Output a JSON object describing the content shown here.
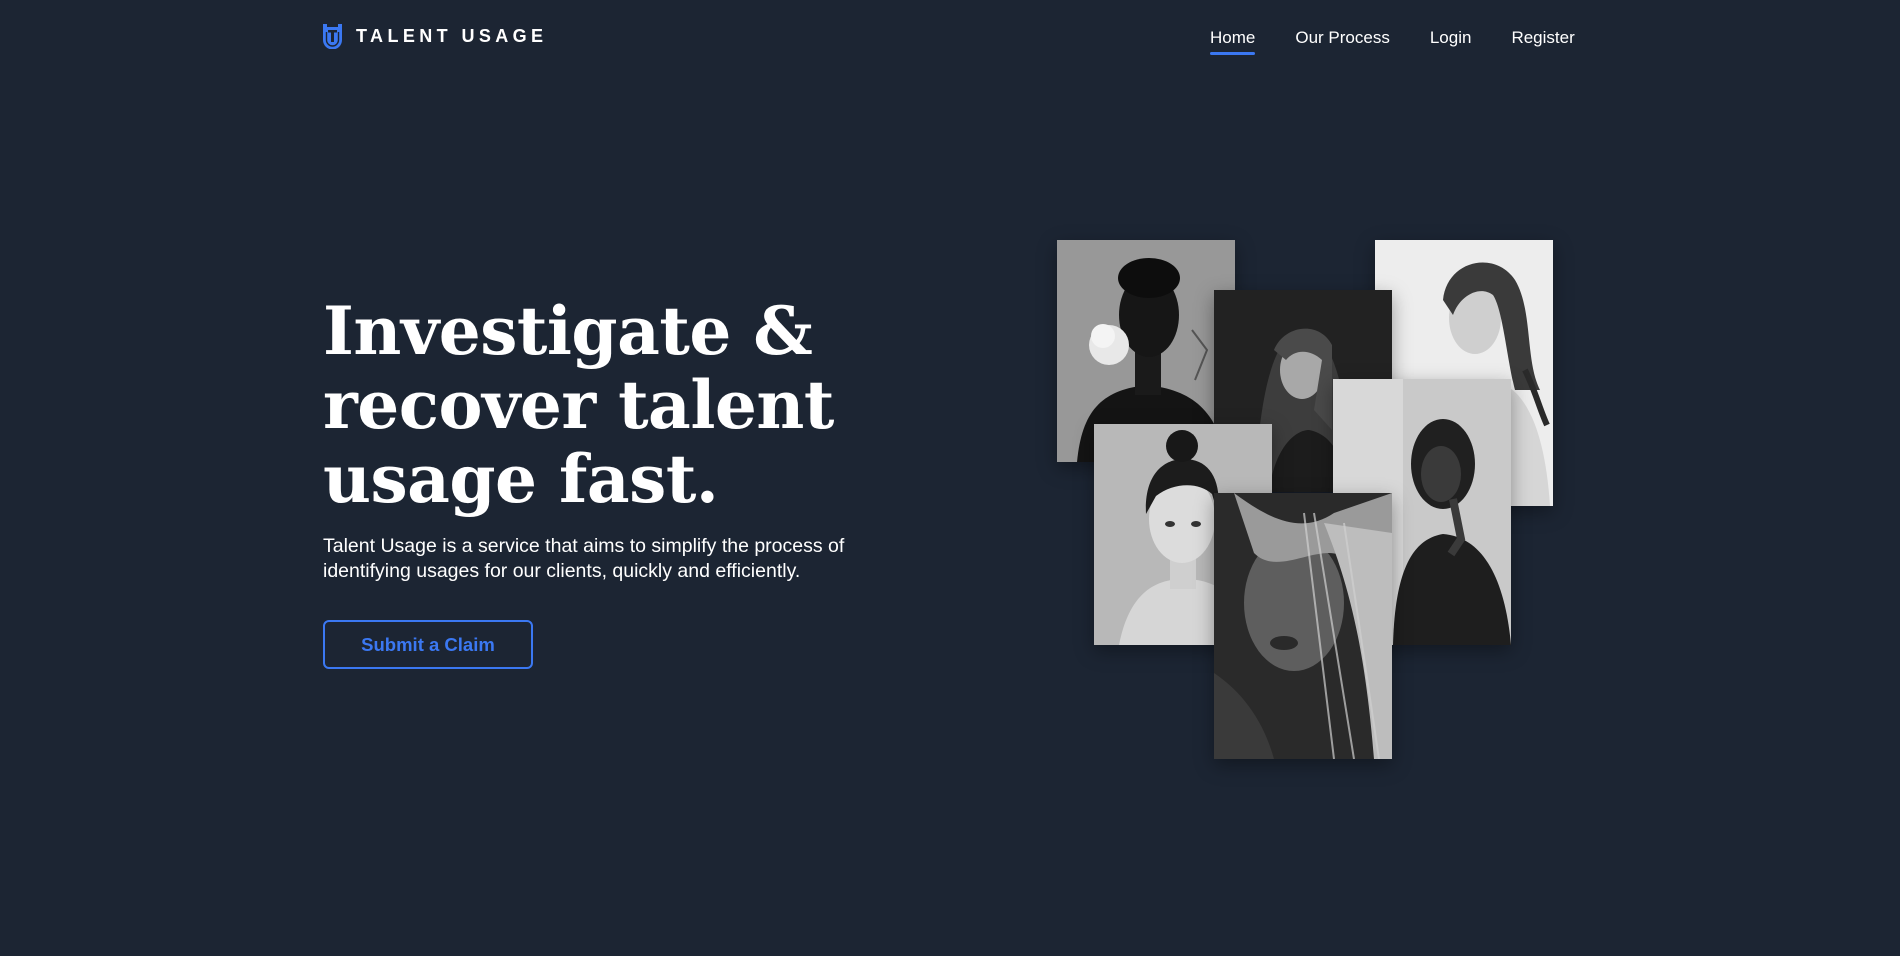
{
  "header": {
    "logo_text": "TALENT USAGE",
    "nav": [
      {
        "label": "Home",
        "active": true
      },
      {
        "label": "Our Process",
        "active": false
      },
      {
        "label": "Login",
        "active": false
      },
      {
        "label": "Register",
        "active": false
      }
    ]
  },
  "hero": {
    "headline_lines": [
      "Investigate &",
      "recover talent",
      "usage fast."
    ],
    "lead": "Talent Usage is a service that aims to simplify the process of identifying usages for our clients, quickly and efficiently.",
    "cta_label": "Submit a Claim"
  },
  "gallery": {
    "photos": [
      {
        "name": "portrait-woman-flower"
      },
      {
        "name": "portrait-woman-long-hair"
      },
      {
        "name": "portrait-woman-shoulder"
      },
      {
        "name": "portrait-woman-headscarf"
      },
      {
        "name": "portrait-woman-bun"
      },
      {
        "name": "portrait-woman-windblown-hair"
      }
    ]
  },
  "colors": {
    "background": "#1c2533",
    "accent": "#3b78f2",
    "text": "#ffffff"
  },
  "icons": {
    "logo": "talent-usage-shield-logo"
  }
}
